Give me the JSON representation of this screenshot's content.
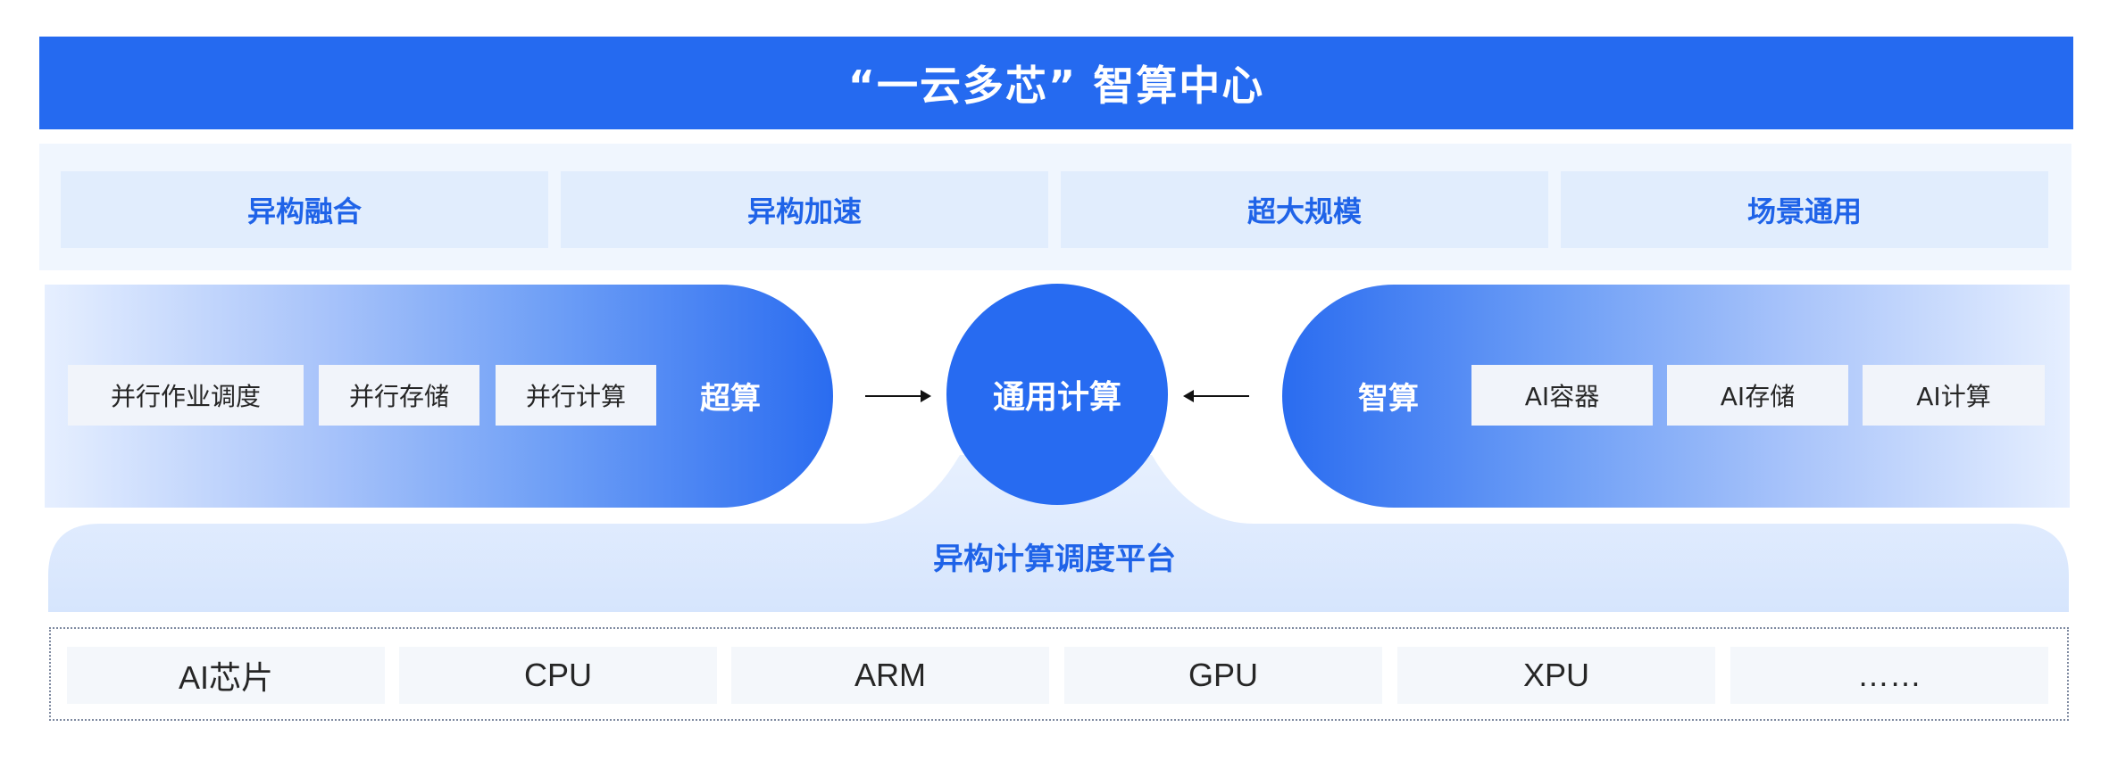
{
  "header": {
    "title": "“一云多芯” 智算中心"
  },
  "features": [
    "异构融合",
    "异构加速",
    "超大规模",
    "场景通用"
  ],
  "supercomputing": {
    "label": "超算",
    "items": [
      "并行作业调度",
      "并行存储",
      "并行计算"
    ]
  },
  "center": {
    "label": "通用计算"
  },
  "intelligent_computing": {
    "label": "智算",
    "items": [
      "AI容器",
      "AI存储",
      "AI计算"
    ]
  },
  "platform": {
    "label": "异构计算调度平台"
  },
  "chips": [
    "AI芯片",
    "CPU",
    "ARM",
    "GPU",
    "XPU",
    "……"
  ],
  "colors": {
    "primary": "#256af0",
    "feature_text": "#1f63e8",
    "feature_bg": "#e1edfd",
    "band_bg": "#f0f6fe",
    "box_bg": "#f1f4fa",
    "text_dark": "#262626"
  }
}
